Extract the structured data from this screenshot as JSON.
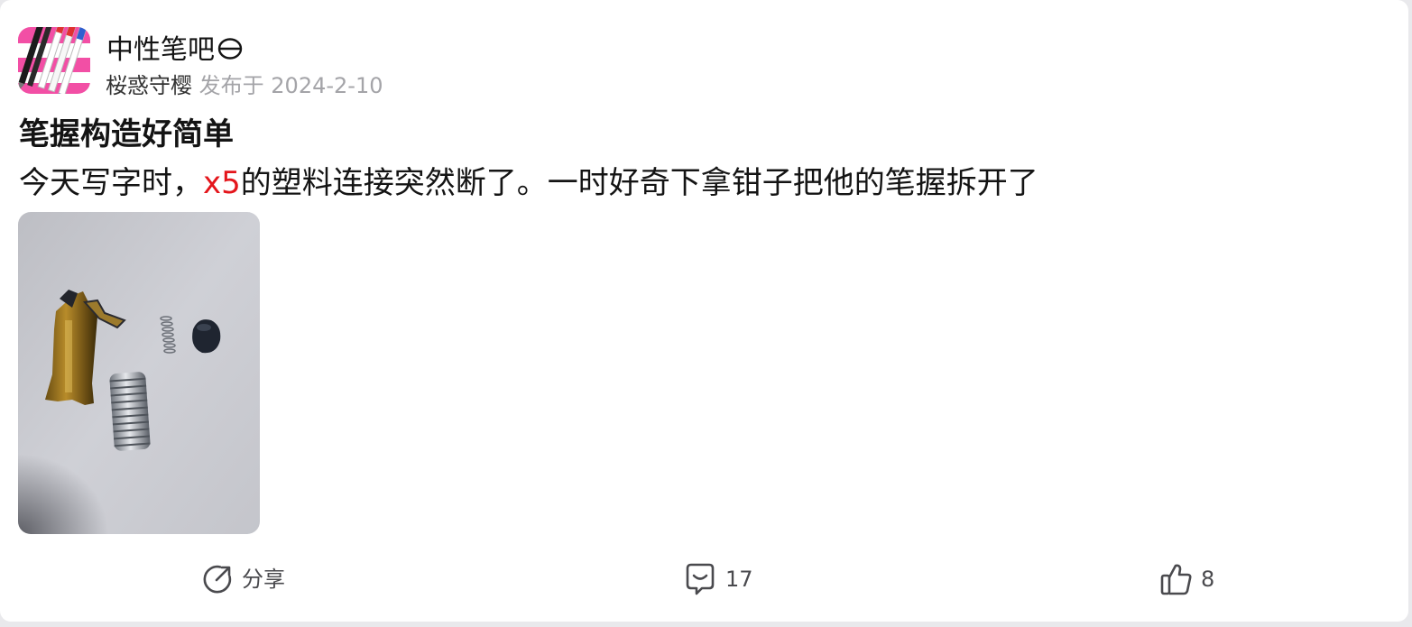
{
  "post": {
    "forum_name": "中性笔吧",
    "author": "桜惑守樱",
    "published_label": "发布于",
    "published_date": "2024-2-10",
    "title": "笔握构造好简单",
    "body_prefix": "今天写字时，",
    "body_mention": "x5",
    "body_suffix": "的塑料连接突然断了。一时好奇下拿钳子把他的笔握拆开了"
  },
  "actions": {
    "share_label": "分享",
    "comment_count": "17",
    "like_count": "8"
  },
  "icons": {
    "forum_sign": "sign-in-icon",
    "share": "share-icon",
    "comment": "comment-icon",
    "like": "thumbs-up-icon"
  },
  "colors": {
    "mention": "#e4151b",
    "meta_gray": "#a4a4a8",
    "text": "#141414",
    "icon_gray": "#4a4a4e",
    "avatar_pink": "#f24fa5"
  }
}
